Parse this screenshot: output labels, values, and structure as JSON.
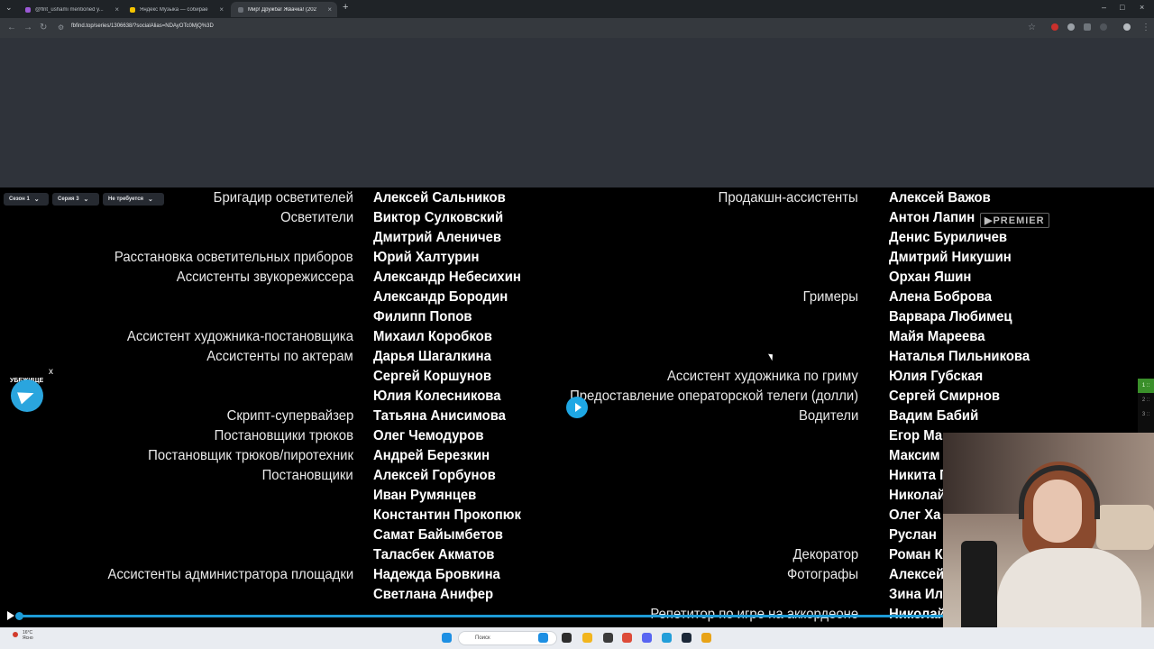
{
  "browser": {
    "tabs": [
      {
        "label": "@flnt_ushami mentioned y...",
        "fav_color": "#9b59d6",
        "active": false
      },
      {
        "label": "Яндекс Музыка — собираем...",
        "fav_color": "#f5c400",
        "active": false
      },
      {
        "label": "Мир! Дружба! Жвачка! (2020)",
        "fav_color": "#6a6f76",
        "active": true
      }
    ],
    "new_tab": "+",
    "close_glyph": "×",
    "url": "fbfind.top/series/1306638/?socialAlias=NDAyOTc0MjQ%3D",
    "window_controls": [
      "–",
      "□",
      "×"
    ]
  },
  "player": {
    "selectors": [
      {
        "label": "Сезон 1",
        "chevron": "⌄"
      },
      {
        "label": "Серия 3",
        "chevron": "⌄"
      },
      {
        "label": "Не требуется",
        "chevron": "⌄"
      }
    ],
    "left_roles": [
      {
        "text": "Бригадир осветителей",
        "row": 0
      },
      {
        "text": "Осветители",
        "row": 1
      },
      {
        "text": "Расстановка осветительных приборов",
        "row": 3
      },
      {
        "text": "Ассистенты звукорежиссера",
        "row": 4
      },
      {
        "text": "Ассистент художника-постановщика",
        "row": 7
      },
      {
        "text": "Ассистенты по актерам",
        "row": 8
      },
      {
        "text": "Скрипт-супервайзер",
        "row": 11
      },
      {
        "text": "Постановщики трюков",
        "row": 12
      },
      {
        "text": "Постановщик трюков/пиротехник",
        "row": 13
      },
      {
        "text": "Постановщики",
        "row": 14
      },
      {
        "text": "Ассистенты администратора площадки",
        "row": 19
      }
    ],
    "left_names": [
      "Алексей Сальников",
      "Виктор Сулковский",
      "Дмитрий Аленичев",
      "Юрий Халтурин",
      "Александр Небесихин",
      "Александр Бородин",
      "Филипп Попов",
      "Михаил Коробков",
      "Дарья Шагалкина",
      "Сергей Коршунов",
      "Юлия Колесникова",
      "Татьяна Анисимова",
      "Олег Чемодуров",
      "Андрей Березкин",
      "Алексей Горбунов",
      "Иван Румянцев",
      "Константин Прокопюк",
      "Самат Байымбетов",
      "Таласбек Акматов",
      "Надежда Бровкина",
      "Светлана Анифер"
    ],
    "right_roles": [
      {
        "text": "Продакшн-ассистенты",
        "row": 0
      },
      {
        "text": "Гримеры",
        "row": 5
      },
      {
        "text": "Ассистент художника по гриму",
        "row": 9
      },
      {
        "text": "Предоставление операторской телеги (долли)",
        "row": 10
      },
      {
        "text": "Водители",
        "row": 11
      },
      {
        "text": "Декоратор",
        "row": 18
      },
      {
        "text": "Фотографы",
        "row": 19
      },
      {
        "text": "Репетитор по игре на аккордеоне",
        "row": 21
      }
    ],
    "right_names": [
      "Алексей Важов",
      "Антон Лапин",
      "Денис Буриличев",
      "Дмитрий Никушин",
      "Орхан Яшин",
      "Алена Боброва",
      "Варвара Любимец",
      "Майя Мареева",
      "Наталья Пильникова",
      "Юлия Губская",
      "Сергей Смирнов",
      "Вадим Бабий",
      "Егор Ма",
      "Максим",
      "Никита Г",
      "Николай",
      "Олег Ха",
      "Руслан",
      "Роман К",
      "Алексей",
      "Зина Ил",
      "Николай"
    ],
    "premier_badge": "▶PREMIER",
    "side_widget": [
      "1 ::",
      "2 ::",
      "3 ::"
    ],
    "progress": 1.0
  },
  "telegram": {
    "label": "УБЕЖИЩЕ",
    "close": "x"
  },
  "taskbar": {
    "temp": "16°C",
    "weather": "Ясно",
    "search_placeholder": "Поиск",
    "icon_colors": [
      "#1d8fe3",
      "#2d2d2d",
      "#f2b51d",
      "#3b3b3b",
      "#dd4b39",
      "#5865f2",
      "#229ed9",
      "#1b2838",
      "#e8a317"
    ]
  }
}
